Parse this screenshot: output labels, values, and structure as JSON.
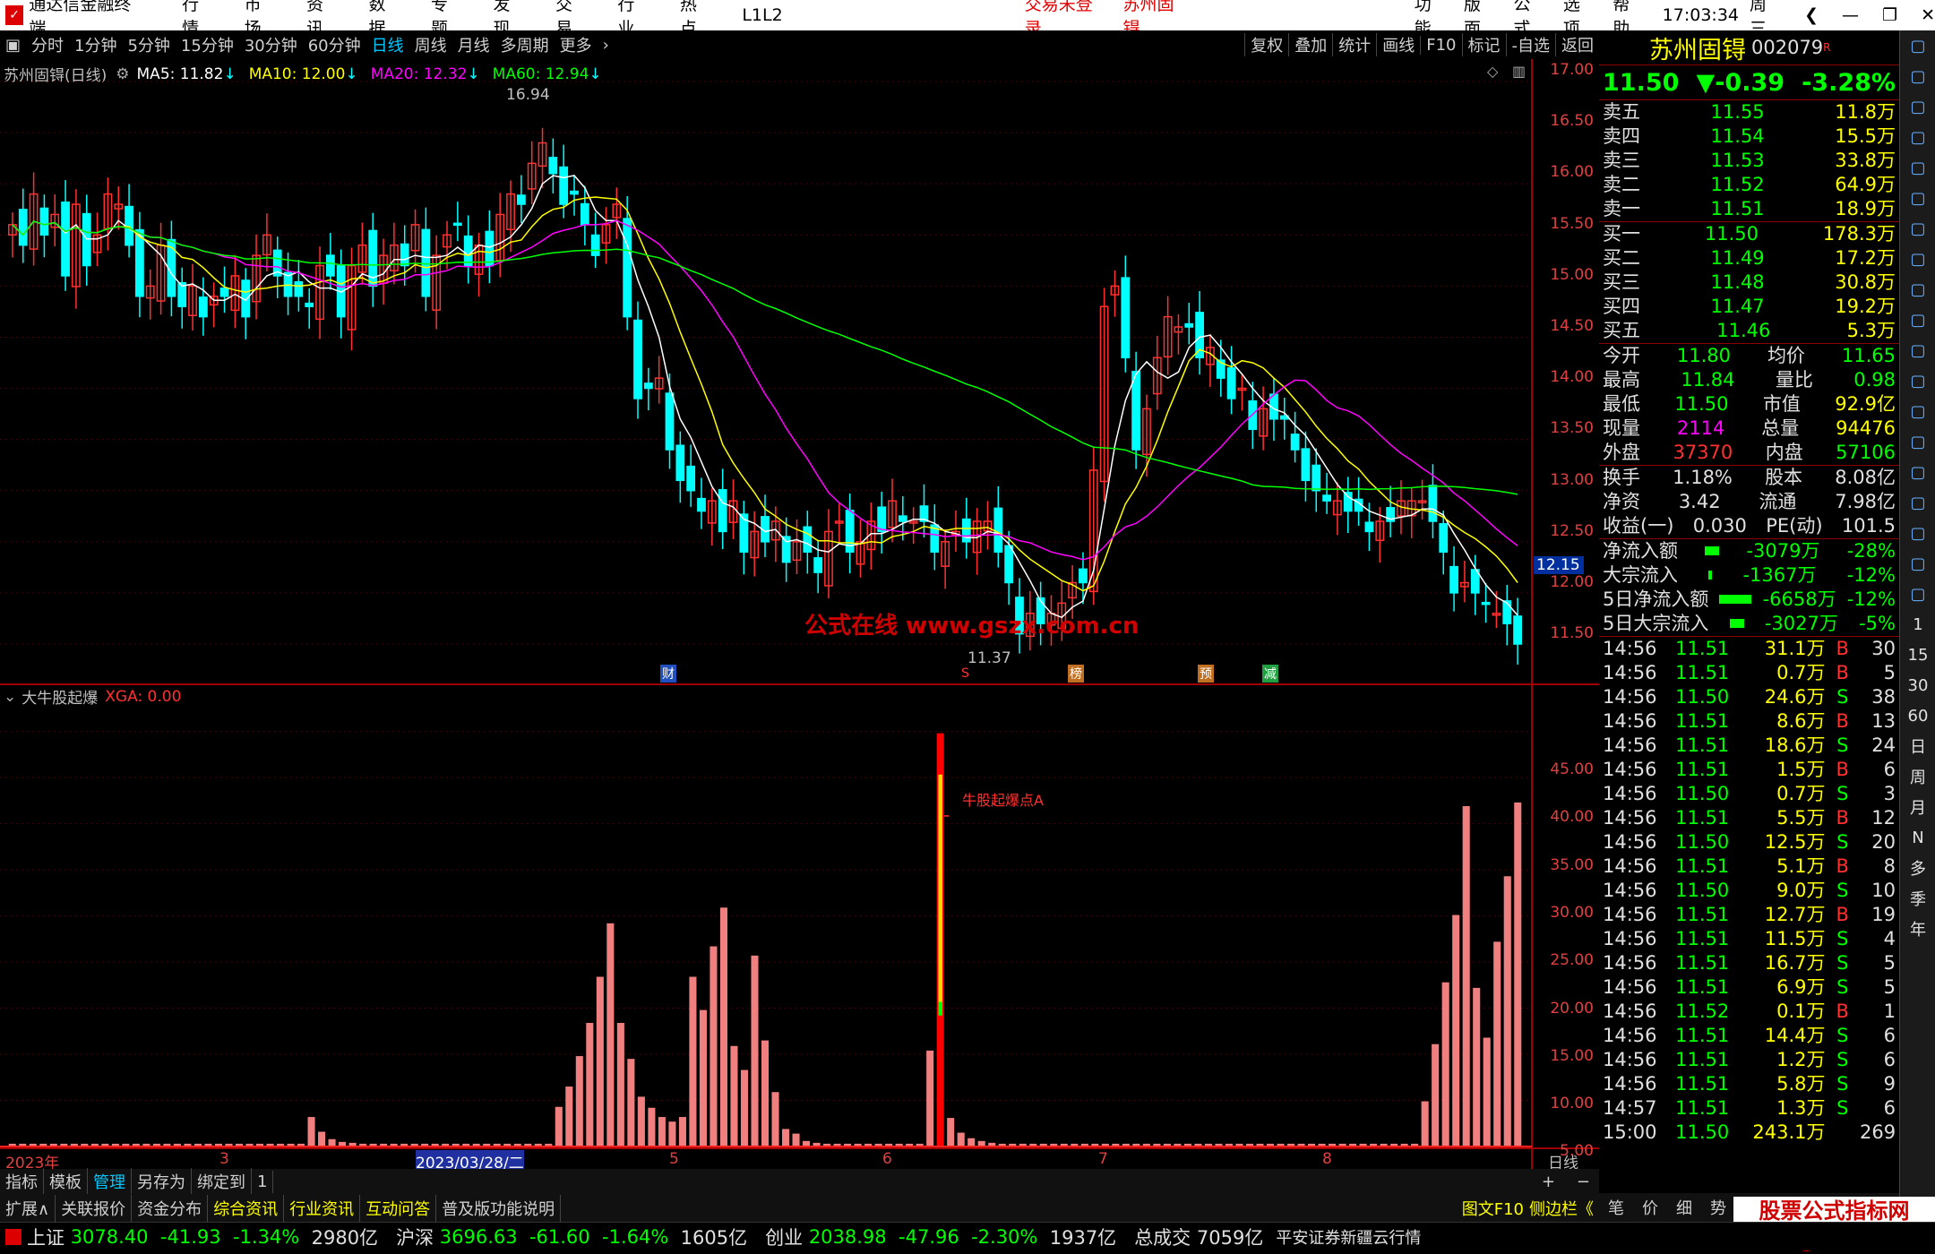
{
  "titlebar": {
    "app": "通达信金融终端",
    "menus": [
      "行情",
      "市场",
      "资讯",
      "数据",
      "专题",
      "发现",
      "交易",
      "行业",
      "热点",
      "L1L2"
    ],
    "status": "交易未登录",
    "stock": "苏州固锝",
    "right_menus": [
      "功能",
      "版面",
      "公式",
      "选项",
      "帮助"
    ],
    "time": "17:03:34",
    "weekday": "周三"
  },
  "toolbar": {
    "periods": [
      "分时",
      "1分钟",
      "5分钟",
      "15分钟",
      "30分钟",
      "60分钟",
      "日线",
      "周线",
      "月线",
      "多周期",
      "更多"
    ],
    "selected": "日线",
    "right": [
      "复权",
      "叠加",
      "统计",
      "画线",
      "F10",
      "标记",
      "-自选",
      "返回"
    ]
  },
  "chart_header": {
    "name": "苏州固锝(日线)",
    "ma5": "MA5: 11.82",
    "ma10": "MA10: 12.00",
    "ma20": "MA20: 12.32",
    "ma60": "MA60: 12.94"
  },
  "price_axis": [
    "17.00",
    "16.50",
    "16.00",
    "15.50",
    "15.00",
    "14.50",
    "14.00",
    "13.50",
    "13.00",
    "12.50",
    "12.00",
    "11.50"
  ],
  "price_tag": "12.15",
  "annotations": {
    "high": "16.94",
    "low": "11.37",
    "watermark": "公式在线  www.gszx.com.cn",
    "signal": "牛股起爆点A"
  },
  "event_marks": [
    "财",
    "S",
    "榜",
    "预",
    "减"
  ],
  "indicator_header": {
    "name": "大牛股起爆",
    "value": "XGA: 0.00"
  },
  "indicator_axis": [
    "45.00",
    "40.00",
    "35.00",
    "30.00",
    "25.00",
    "20.00",
    "15.00",
    "10.00",
    "5.00"
  ],
  "x_axis": {
    "year": "2023年",
    "m3": "3",
    "date": "2023/03/28/二",
    "m5": "5",
    "m6": "6",
    "m7": "7",
    "m8": "8",
    "period": "日线"
  },
  "colors": {
    "up": "#ff3030",
    "down": "#00ffff",
    "ma5": "#ffffff",
    "ma10": "#ffff00",
    "ma20": "#ff00ff",
    "ma60": "#00ff00",
    "bar": "#f08080"
  },
  "chart_data": [
    {
      "type": "candlestick",
      "title": "苏州固锝(日线)",
      "ylim": [
        11.4,
        17.1
      ],
      "close": [
        15.6,
        15.4,
        15.9,
        15.5,
        15.7,
        15.1,
        15.8,
        15.2,
        15.5,
        15.9,
        15.8,
        15.4,
        14.9,
        15.0,
        15.4,
        14.9,
        14.8,
        15.0,
        14.7,
        14.9,
        14.9,
        15.1,
        14.7,
        15.3,
        15.5,
        15.1,
        14.9,
        14.9,
        14.8,
        15.2,
        15.1,
        14.7,
        15.2,
        15.4,
        15.0,
        15.3,
        15.4,
        15.2,
        15.6,
        14.9,
        15.3,
        15.5,
        15.6,
        15.2,
        15.4,
        15.2,
        15.7,
        15.9,
        15.8,
        16.2,
        16.4,
        16.1,
        15.8,
        15.9,
        15.6,
        15.3,
        15.6,
        15.8,
        14.7,
        13.9,
        14.0,
        14.1,
        13.4,
        13.1,
        13.0,
        12.8,
        12.9,
        12.6,
        12.9,
        12.4,
        12.6,
        12.5,
        12.7,
        12.3,
        12.5,
        12.4,
        12.2,
        12.6,
        12.7,
        12.4,
        12.5,
        12.7,
        12.6,
        12.9,
        12.7,
        12.7,
        12.7,
        12.4,
        12.5,
        12.6,
        12.5,
        12.7,
        12.7,
        12.4,
        12.1,
        11.6,
        11.8,
        11.7,
        11.8,
        11.9,
        12.1,
        12.1,
        13.2,
        14.8,
        15.0,
        14.3,
        13.4,
        13.8,
        14.3,
        14.7,
        14.6,
        14.6,
        14.3,
        14.4,
        14.1,
        13.9,
        14.0,
        13.6,
        13.8,
        13.7,
        13.7,
        13.4,
        13.1,
        13.0,
        12.9,
        12.9,
        12.8,
        12.8,
        12.6,
        12.7,
        12.7,
        12.9,
        12.9,
        12.9,
        12.7,
        12.4,
        12.0,
        12.1,
        12.0,
        11.9,
        11.8,
        11.7,
        11.5
      ]
    },
    {
      "type": "bar",
      "title": "大牛股起爆",
      "ylim": [
        0,
        47
      ],
      "values": [
        0.3,
        0.3,
        0.3,
        0.3,
        0.3,
        0.3,
        0.3,
        0.3,
        0.3,
        0.3,
        0.3,
        0.3,
        0.3,
        0.3,
        0.3,
        0.3,
        0.3,
        0.3,
        0.3,
        0.3,
        0.3,
        0.3,
        0.3,
        0.3,
        0.3,
        0.3,
        0.3,
        0.3,
        0.3,
        3.2,
        1.6,
        0.8,
        0.5,
        0.4,
        0.3,
        0.3,
        0.3,
        0.3,
        0.3,
        0.3,
        0.3,
        0.3,
        0.3,
        0.3,
        0.3,
        0.3,
        0.3,
        0.3,
        0.3,
        0.3,
        0.3,
        0.3,
        0.3,
        4.3,
        6.5,
        9.8,
        13.4,
        18.4,
        24.2,
        13.4,
        9.5,
        5.4,
        4.2,
        3.2,
        2.7,
        3.2,
        18.4,
        14.8,
        21.7,
        25.9,
        10.9,
        8.3,
        20.7,
        11.5,
        5.9,
        1.9,
        1.4,
        0.6,
        0.4,
        0.3,
        0.3,
        0.3,
        0.3,
        0.3,
        0.3,
        0.3,
        0.3,
        0.3,
        0.3,
        10.4,
        44.8,
        3.1,
        1.5,
        0.9,
        0.6,
        0.4,
        0.3,
        0.3,
        0.3,
        0.3,
        0.3,
        0.3,
        0.3,
        0.3,
        0.3,
        0.3,
        0.3,
        0.3,
        0.3,
        0.3,
        0.3,
        0.3,
        0.3,
        0.3,
        0.3,
        0.3,
        0.3,
        0.3,
        0.3,
        0.3,
        0.3,
        0.3,
        0.3,
        0.3,
        0.3,
        0.3,
        0.3,
        0.3,
        0.3,
        0.3,
        0.3,
        0.3,
        0.3,
        0.3,
        0.3,
        0.3,
        0.3,
        4.9,
        11.1,
        17.8,
        25.1,
        36.9,
        17.2,
        11.8,
        22.2,
        29.3,
        37.3
      ]
    }
  ],
  "quote": {
    "name": "苏州固锝",
    "code": "002079",
    "price": "11.50",
    "change": "▼-0.39",
    "pct": "-3.28%",
    "sells": [
      [
        "卖五",
        "11.55",
        "11.8万"
      ],
      [
        "卖四",
        "11.54",
        "15.5万"
      ],
      [
        "卖三",
        "11.53",
        "33.8万"
      ],
      [
        "卖二",
        "11.52",
        "64.9万"
      ],
      [
        "卖一",
        "11.51",
        "18.9万"
      ]
    ],
    "buys": [
      [
        "买一",
        "11.50",
        "178.3万"
      ],
      [
        "买二",
        "11.49",
        "17.2万"
      ],
      [
        "买三",
        "11.48",
        "30.8万"
      ],
      [
        "买四",
        "11.47",
        "19.2万"
      ],
      [
        "买五",
        "11.46",
        "5.3万"
      ]
    ],
    "stats": [
      [
        "今开",
        "11.80",
        "均价",
        "11.65"
      ],
      [
        "最高",
        "11.84",
        "量比",
        "0.98"
      ],
      [
        "最低",
        "11.50",
        "市值",
        "92.9亿"
      ],
      [
        "现量",
        "2114",
        "总量",
        "94476"
      ],
      [
        "外盘",
        "37370",
        "内盘",
        "57106"
      ],
      [
        "换手",
        "1.18%",
        "股本",
        "8.08亿"
      ],
      [
        "净资",
        "3.42",
        "流通",
        "7.98亿"
      ],
      [
        "收益(一)",
        "0.030",
        "PE(动)",
        "101.5"
      ]
    ],
    "flows": [
      [
        "净流入额",
        "-3079万",
        "-28%"
      ],
      [
        "大宗流入",
        "-1367万",
        "-12%"
      ],
      [
        "5日净流入额",
        "-6658万",
        "-12%"
      ],
      [
        "5日大宗流入",
        "-3027万",
        "-5%"
      ]
    ]
  },
  "ticks": [
    [
      "14:56",
      "11.51",
      "31.1万",
      "B",
      "30"
    ],
    [
      "14:56",
      "11.51",
      "0.7万",
      "B",
      "5"
    ],
    [
      "14:56",
      "11.50",
      "24.6万",
      "S",
      "38"
    ],
    [
      "14:56",
      "11.51",
      "8.6万",
      "B",
      "13"
    ],
    [
      "14:56",
      "11.51",
      "18.6万",
      "S",
      "24"
    ],
    [
      "14:56",
      "11.51",
      "1.5万",
      "B",
      "6"
    ],
    [
      "14:56",
      "11.50",
      "0.7万",
      "S",
      "3"
    ],
    [
      "14:56",
      "11.51",
      "5.5万",
      "B",
      "12"
    ],
    [
      "14:56",
      "11.50",
      "12.5万",
      "S",
      "20"
    ],
    [
      "14:56",
      "11.51",
      "5.1万",
      "B",
      "8"
    ],
    [
      "14:56",
      "11.50",
      "9.0万",
      "S",
      "10"
    ],
    [
      "14:56",
      "11.51",
      "12.7万",
      "B",
      "19"
    ],
    [
      "14:56",
      "11.51",
      "11.5万",
      "S",
      "4"
    ],
    [
      "14:56",
      "11.51",
      "16.7万",
      "S",
      "5"
    ],
    [
      "14:56",
      "11.51",
      "6.9万",
      "S",
      "5"
    ],
    [
      "14:56",
      "11.52",
      "0.1万",
      "B",
      "1"
    ],
    [
      "14:56",
      "11.51",
      "14.4万",
      "S",
      "6"
    ],
    [
      "14:56",
      "11.51",
      "1.2万",
      "S",
      "6"
    ],
    [
      "14:56",
      "11.51",
      "5.8万",
      "S",
      "9"
    ],
    [
      "14:57",
      "11.51",
      "1.3万",
      "S",
      "6"
    ],
    [
      "15:00",
      "11.50",
      "243.1万",
      "",
      "269"
    ]
  ],
  "tabs1": [
    "指标",
    "模板",
    "管理",
    "另存为",
    "绑定到",
    "1"
  ],
  "tabs2": [
    "扩展∧",
    "关联报价",
    "资金分布",
    "综合资讯",
    "行业资讯",
    "互动问答",
    "普及版功能说明"
  ],
  "panel_tabs": [
    "图文F10",
    "侧边栏《",
    "笔",
    "价",
    "细",
    "势"
  ],
  "indices": [
    [
      "上证",
      "3078.40",
      "-41.93",
      "-1.34%",
      "2980亿"
    ],
    [
      "沪深",
      "3696.63",
      "-61.60",
      "-1.64%",
      "1605亿"
    ],
    [
      "创业",
      "2038.98",
      "-47.96",
      "-2.30%",
      "1937亿"
    ]
  ],
  "total": {
    "label": "总成交",
    "value": "7059亿"
  },
  "broker": "平安证券新疆云行情",
  "logo": "股票公式指标网 www.gszx.com.cn",
  "sidebar_icons": [
    "home-icon",
    "up-arrow-icon",
    "down-arrow-icon",
    "chart-icon",
    "grid-icon",
    "list-icon",
    "k-icon",
    "buy-icon",
    "table-icon",
    "fin-icon",
    "kline-icon",
    "page-icon",
    "f-icon",
    "cycle-icon",
    "rsi-icon",
    "diamond-icon",
    "pen-icon",
    "fs-icon",
    "share-icon",
    "1",
    "15",
    "30",
    "60",
    "日",
    "周",
    "月",
    "N",
    "多",
    "季",
    "年"
  ]
}
